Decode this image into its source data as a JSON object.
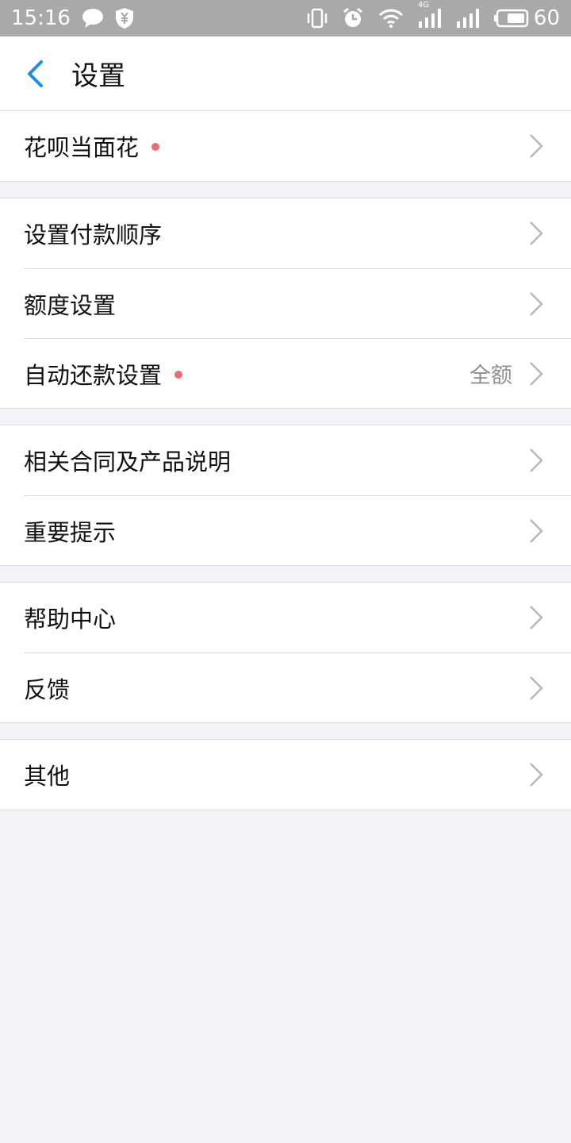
{
  "status_bar": {
    "time": "15:16",
    "network_label": "4G",
    "battery_percent": "60",
    "icons": [
      "chat-bubble-icon",
      "shield-yen-icon",
      "vibrate-icon",
      "alarm-icon",
      "wifi-icon",
      "signal-icon",
      "battery-icon"
    ]
  },
  "header": {
    "title": "设置",
    "back_icon": "chevron-left-icon",
    "accent_color": "#1a8fe3"
  },
  "groups": [
    {
      "items": [
        {
          "label": "花呗当面花",
          "red_dot": true
        }
      ]
    },
    {
      "items": [
        {
          "label": "设置付款顺序"
        },
        {
          "label": "额度设置"
        },
        {
          "label": "自动还款设置",
          "red_dot": true,
          "value": "全额"
        }
      ]
    },
    {
      "items": [
        {
          "label": "相关合同及产品说明"
        },
        {
          "label": "重要提示"
        }
      ]
    },
    {
      "items": [
        {
          "label": "帮助中心"
        },
        {
          "label": "反馈"
        }
      ]
    },
    {
      "items": [
        {
          "label": "其他"
        }
      ]
    }
  ],
  "colors": {
    "background": "#f3f3f7",
    "divider": "#dcdcdc",
    "red_dot": "#ec6d72",
    "chevron": "#b8b8b8"
  }
}
